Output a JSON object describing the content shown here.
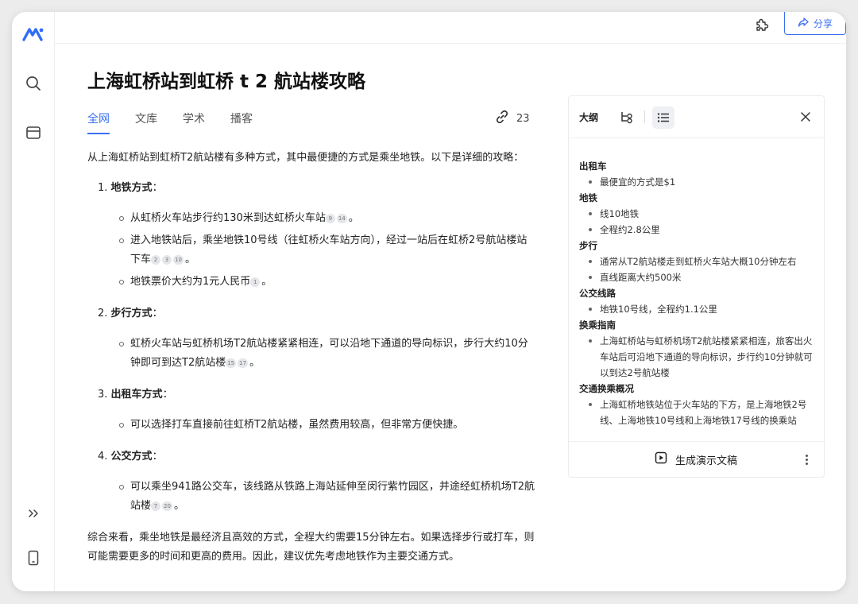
{
  "app": {
    "accent_color": "#3a6ff2"
  },
  "sidebar": {
    "items": [
      {
        "name": "logo",
        "icon": "logo-icon"
      },
      {
        "name": "search",
        "icon": "search-icon"
      },
      {
        "name": "library",
        "icon": "window-icon"
      },
      {
        "name": "expand",
        "icon": "double-chevron-right-icon"
      },
      {
        "name": "mobile",
        "icon": "phone-icon"
      }
    ]
  },
  "topbar": {
    "share_label": "分享"
  },
  "page": {
    "title": "上海虹桥站到虹桥 t 2 航站楼攻略",
    "tabs": [
      {
        "label": "全网",
        "active": true
      },
      {
        "label": "文库",
        "active": false
      },
      {
        "label": "学术",
        "active": false
      },
      {
        "label": "播客",
        "active": false
      }
    ],
    "source_count": "23"
  },
  "article": {
    "intro": "从上海虹桥站到虹桥T2航站楼有多种方式，其中最便捷的方式是乘坐地铁。以下是详细的攻略：",
    "sections": [
      {
        "number": "1.",
        "title": "地铁方式",
        "suffix": "：",
        "items": [
          {
            "text": "从虹桥火车站步行约130米到达虹桥火车站",
            "cites": [
              "9",
              "14"
            ],
            "end": "。"
          },
          {
            "text": "进入地铁站后，乘坐地铁10号线（往虹桥火车站方向），经过一站后在虹桥2号航站楼站下车",
            "cites": [
              "2",
              "3",
              "10"
            ],
            "end": "。"
          },
          {
            "text": "地铁票价大约为1元人民币",
            "cites": [
              "1"
            ],
            "end": "。"
          }
        ]
      },
      {
        "number": "2.",
        "title": "步行方式",
        "suffix": "：",
        "items": [
          {
            "text": "虹桥火车站与虹桥机场T2航站楼紧紧相连，可以沿地下通道的导向标识，步行大约10分钟即可到达T2航站楼",
            "cites": [
              "15",
              "17"
            ],
            "end": "。"
          }
        ]
      },
      {
        "number": "3.",
        "title": "出租车方式",
        "suffix": "：",
        "items": [
          {
            "text": "可以选择打车直接前往虹桥T2航站楼，虽然费用较高，但非常方便快捷。",
            "cites": [],
            "end": ""
          }
        ]
      },
      {
        "number": "4.",
        "title": "公交方式",
        "suffix": "：",
        "items": [
          {
            "text": "可以乘坐941路公交车，该线路从铁路上海站延伸至闵行紫竹园区，并途经虹桥机场T2航站楼",
            "cites": [
              "7",
              "20"
            ],
            "end": "。"
          }
        ]
      }
    ],
    "summary": "综合来看，乘坐地铁是最经济且高效的方式，全程大约需要15分钟左右。如果选择步行或打车，则可能需要更多的时间和更高的费用。因此，建议优先考虑地铁作为主要交通方式。"
  },
  "outline": {
    "title": "大纲",
    "groups": [
      {
        "heading": "出租车",
        "items": [
          "最便宜的方式是$1"
        ]
      },
      {
        "heading": "地铁",
        "items": [
          "线10地铁",
          "全程约2.8公里"
        ]
      },
      {
        "heading": "步行",
        "items": [
          "通常从T2航站楼走到虹桥火车站大概10分钟左右",
          "直线距离大约500米"
        ]
      },
      {
        "heading": "公交线路",
        "items": [
          "地铁10号线，全程约1.1公里"
        ]
      },
      {
        "heading": "换乘指南",
        "items": [
          "上海虹桥站与虹桥机场T2航站楼紧紧相连，旅客出火车站后可沿地下通道的导向标识，步行约10分钟就可以到达2号航站楼"
        ]
      },
      {
        "heading": "交通换乘概况",
        "items": [
          "上海虹桥地铁站位于火车站的下方，是上海地铁2号线、上海地铁10号线和上海地铁17号线的换乘站"
        ]
      }
    ],
    "generate_label": "生成演示文稿"
  }
}
